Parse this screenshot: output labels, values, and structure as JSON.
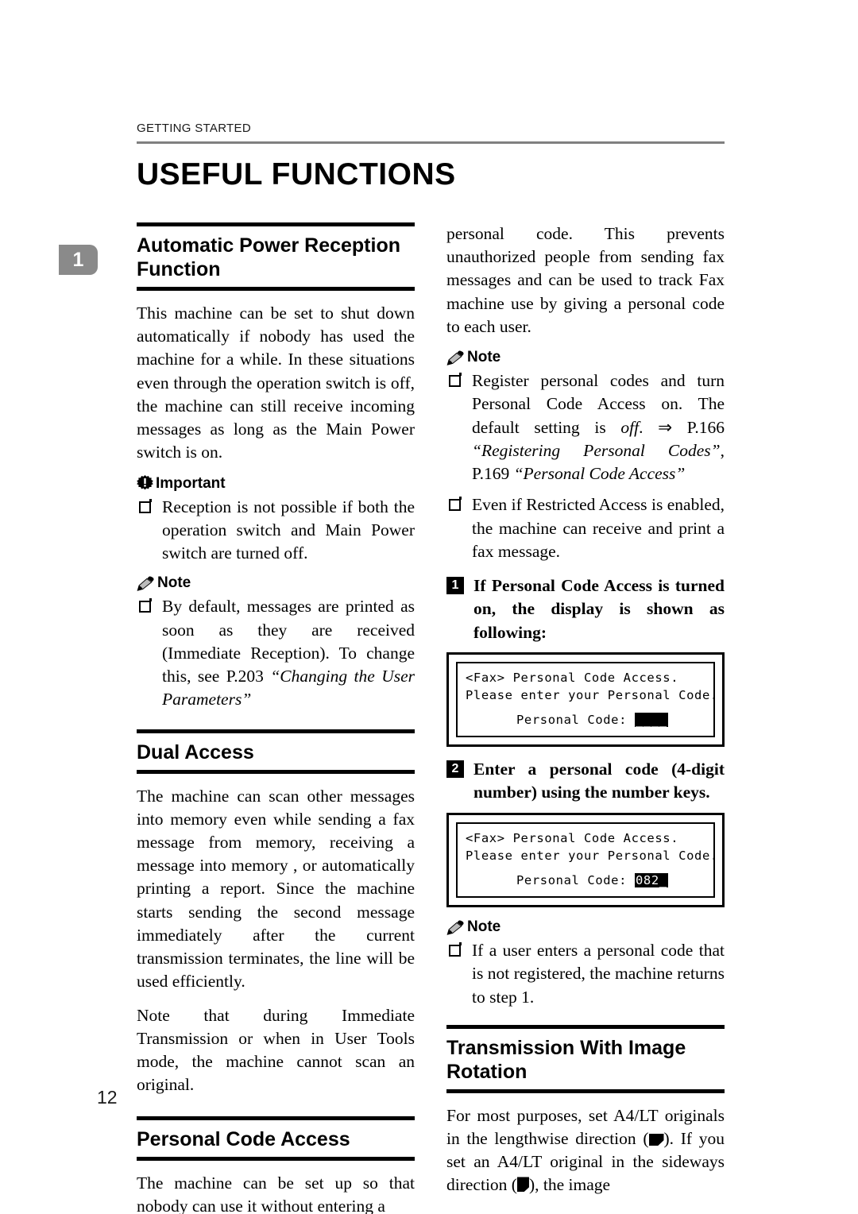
{
  "header": {
    "running_head": "GETTING STARTED",
    "page_title": "USEFUL FUNCTIONS",
    "chapter_tab": "1",
    "page_number": "12"
  },
  "left_column": {
    "section_1": {
      "title": "Automatic Power Reception Function",
      "paragraph": "This machine can be set to shut down automatically if nobody has used the machine for a while. In these situations even through the operation switch is off, the machine can still receive incoming messages as long as the Main Power switch is on.",
      "important_label": "Important",
      "important_items": [
        "Reception is not possible if both the operation switch and Main Power switch are turned off."
      ],
      "note_label": "Note",
      "note_item_prefix": "By default, messages are printed as soon as they are received (Immediate Reception). To change this, see P.203 ",
      "note_item_italic": "“Changing the User Parameters”"
    },
    "section_2": {
      "title": "Dual Access",
      "paragraph_1": "The machine can scan other messages into memory even while sending a fax message from memory, receiving a message into memory , or automatically printing a report. Since the machine starts sending the second message immediately after the current transmission terminates, the line will be used efficiently.",
      "paragraph_2": "Note that during Immediate Transmission or when in User Tools mode, the machine cannot scan an original."
    },
    "section_3": {
      "title": "Personal Code Access",
      "paragraph": "The machine can be set up so that nobody can use it without entering a"
    }
  },
  "right_column": {
    "continued_paragraph": "personal code. This prevents unauthorized people from sending fax messages and can be used to track Fax machine use by giving a personal code to each user.",
    "note_label_1": "Note",
    "note_1_item_1_a": "Register personal codes and turn Personal Code Access on. The default setting is ",
    "note_1_item_1_off": "off",
    "note_1_item_1_b": ". ⇒ P.166 ",
    "note_1_item_1_ref1": "“Registering Personal Codes”",
    "note_1_item_1_c": ", P.169 ",
    "note_1_item_1_ref2": "“Personal Code Access”",
    "note_1_item_2": "Even if Restricted Access is enabled, the machine can receive and print a fax message.",
    "step_1": {
      "number": "1",
      "text": "If Personal Code Access is turned on, the display is shown as following:"
    },
    "lcd_1": {
      "line_1": "<Fax> Personal Code Access.",
      "line_2": "Please enter your Personal Code.",
      "line_3_label": "Personal Code: ",
      "line_3_value": "____"
    },
    "step_2": {
      "number": "2",
      "text": "Enter a personal code (4-digit number) using the number keys."
    },
    "lcd_2": {
      "line_1": "<Fax> Personal Code Access.",
      "line_2": "Please enter your Personal Code.",
      "line_3_label": "Personal Code: ",
      "line_3_value": "082_"
    },
    "note_label_2": "Note",
    "note_2_item_1": "If a user enters a personal code that is not registered, the machine returns to step 1.",
    "section_4": {
      "title": "Transmission With Image Rotation",
      "paragraph_a": "For most purposes, set A4/LT originals in the lengthwise direction (",
      "paragraph_b": "). If you set an A4/LT original in the sideways direction (",
      "paragraph_c": "), the image"
    }
  },
  "colors": {
    "rule_gray": "#808080",
    "tab_gray": "#8a8a8a",
    "ink": "#000000"
  }
}
